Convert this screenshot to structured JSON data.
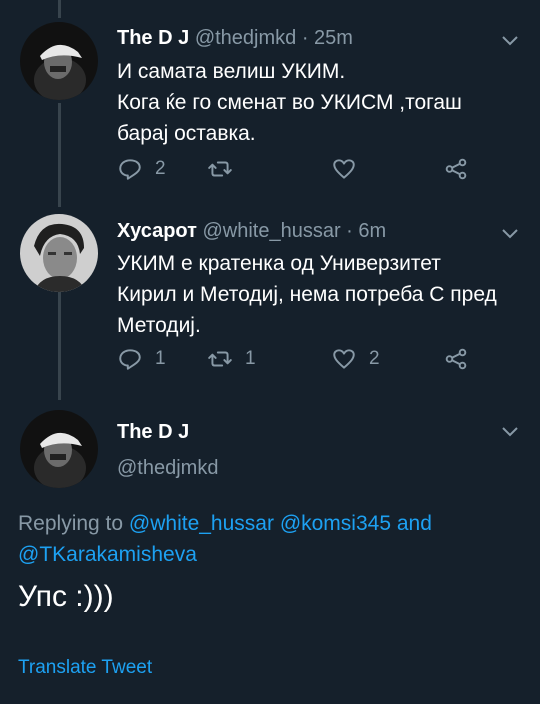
{
  "tweets": [
    {
      "name": "The  D J",
      "meta": "@thedjmkd · 25m",
      "lines": [
        "И самата велиш УКИМ.",
        "Кога ќе го сменат во УКИСМ ,тогаш",
        "барај оставка."
      ],
      "replies": "2",
      "retweets": "",
      "likes": ""
    },
    {
      "name": "Хусарот",
      "meta": "@white_hussar · 6m",
      "lines": [
        "УКИМ е кратенка од Универзитет",
        "Кирил и Методиј, нема потреба С пред",
        "Методиј."
      ],
      "replies": "1",
      "retweets": "1",
      "likes": "2"
    }
  ],
  "main_tweet": {
    "name": "The  D J",
    "handle": "@thedjmkd",
    "replying_prefix": "Replying to ",
    "mention1": "@white_hussar",
    "mention2": "@komsi345",
    "and_text": " and",
    "mention3": "@TKarakamisheva",
    "text": "Упс :)))",
    "translate": "Translate Tweet"
  },
  "colors": {
    "background": "#15202b",
    "secondary_text": "#8899a6",
    "accent": "#1da1f2",
    "thread_line": "#38444d"
  }
}
